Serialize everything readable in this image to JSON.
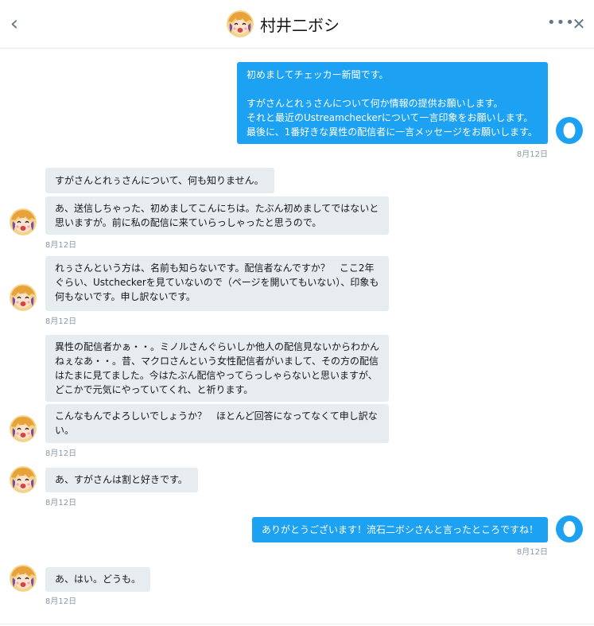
{
  "header": {
    "title": "村井二ボシ",
    "back_icon": "‹",
    "more_icon": "•••",
    "close_icon": "✕"
  },
  "colors": {
    "outgoing_bubble": "#1da1f2",
    "incoming_bubble": "#e6ecf0",
    "timestamp": "#8899a6"
  },
  "messages": [
    {
      "direction": "out",
      "text": "初めましてチェッカー新聞です。\n\nすがさんとれぅさんについて何か情報の提供お願いします。\nそれと最近のUstreamcheckerについて一言印象をお願いします。\n最後に、1番好きな異性の配信者に一言メッセージをお願いします。",
      "time": "8月12日"
    },
    {
      "direction": "in",
      "text": "すがさんとれぅさんについて、何も知りません。"
    },
    {
      "direction": "in",
      "text": "あ、送信しちゃった、初めましてこんにちは。たぶん初めましてではないと思いますが。前に私の配信に来ていらっしゃったと思うので。",
      "time": "8月12日"
    },
    {
      "direction": "in",
      "text": "れぅさんという方は、名前も知らないです。配信者なんですか？　ここ2年ぐらい、Ustcheckerを見ていないので（ページを開いてもいない）、印象も何もないです。申し訳ないです。",
      "time": "8月12日"
    },
    {
      "direction": "in",
      "text": "異性の配信者かぁ・・。ミノルさんぐらいしか他人の配信見ないからわかんねぇなあ・・。昔、マクロさんという女性配信者がいまして、その方の配信はたまに見てました。今はたぶん配信やってらっしゃらないと思いますが、どこかで元気にやっていてくれ、と祈ります。"
    },
    {
      "direction": "in",
      "text": "こんなもんでよろしいでしょうか？　ほとんど回答になってなくて申し訳ない。",
      "time": "8月12日"
    },
    {
      "direction": "in",
      "text": "あ、すがさんは割と好きです。",
      "time": "8月12日"
    },
    {
      "direction": "out",
      "text": "ありがとうございます！流石二ボシさんと言ったところですね！",
      "time": "8月12日"
    },
    {
      "direction": "in",
      "text": "あ、はい。どうも。",
      "time": "8月12日"
    }
  ]
}
